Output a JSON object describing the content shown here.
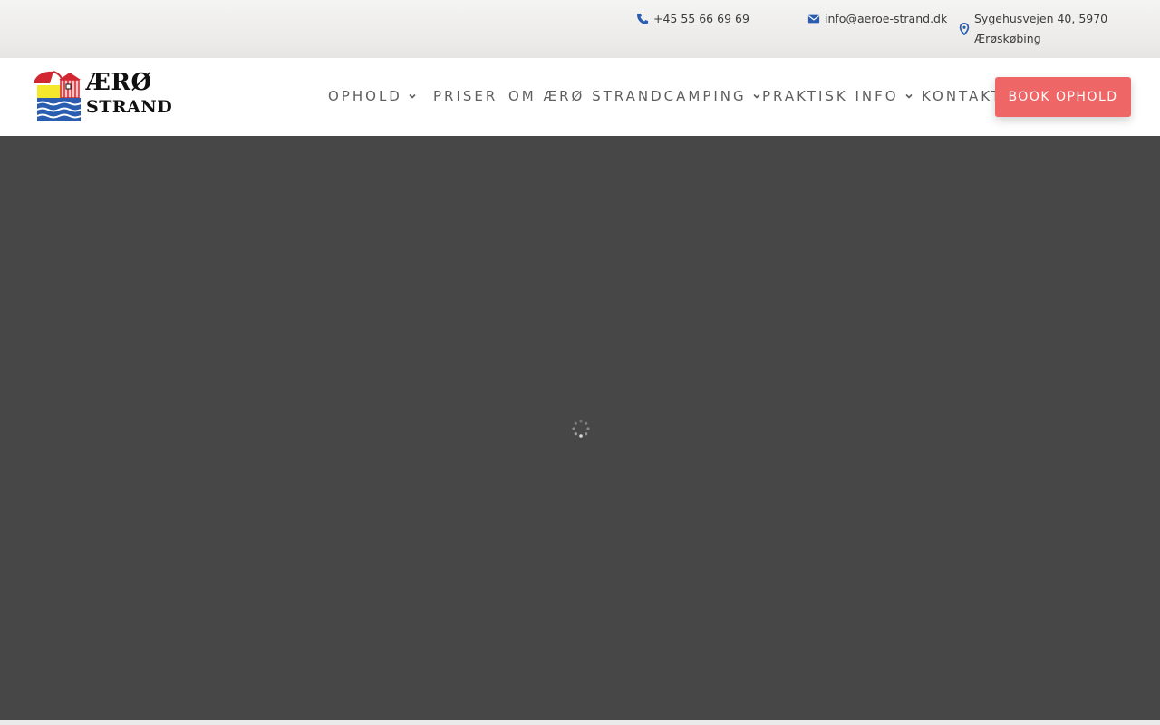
{
  "topbar": {
    "phone": "+45 55 66 69 69",
    "email": "info@aeroe-strand.dk",
    "address_line1": "Sygehusvejen 40, 5970",
    "address_line2": "Ærøskøbing",
    "icons": [
      "phone-icon",
      "envelope-icon",
      "map-pin-icon"
    ],
    "icon_color": "#2a5db0"
  },
  "header": {
    "logo_line1": "ÆRØ",
    "logo_line2": "STRAND",
    "nav": [
      {
        "label": "OPHOLD",
        "has_dropdown": true
      },
      {
        "label": "PRISER",
        "has_dropdown": false
      },
      {
        "label": "OM ÆRØ STRANDCAMPING",
        "has_dropdown": true
      },
      {
        "label": "PRAKTISK INFO",
        "has_dropdown": true
      },
      {
        "label": "KONTAKT",
        "has_dropdown": false
      }
    ],
    "book_button": "BOOK OPHOLD",
    "book_button_color": "#ef6666"
  },
  "hero": {
    "background_color": "#474747",
    "state": "loading-spinner"
  }
}
